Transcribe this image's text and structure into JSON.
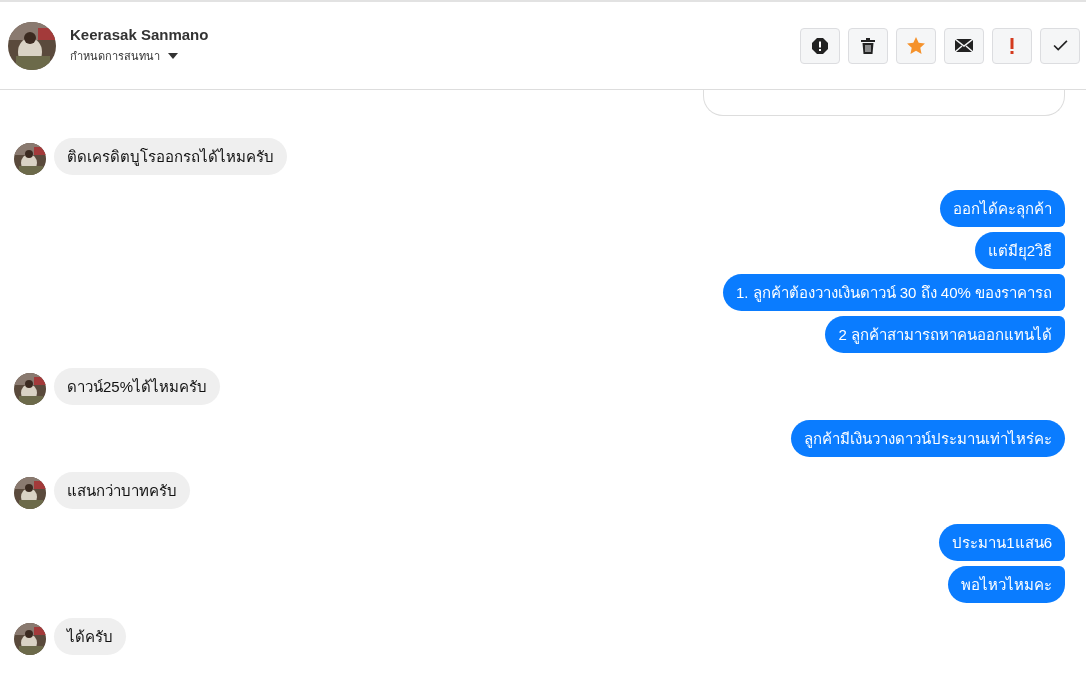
{
  "header": {
    "name": "Keerasak Sanmano",
    "subtitle": "กำหนดการสนทนา",
    "starred": true
  },
  "groups": [
    {
      "kind": "partial"
    },
    {
      "kind": "incoming",
      "messages": [
        "ติดเครดิตบูโรออกรถได้ไหมครับ"
      ]
    },
    {
      "kind": "outgoing",
      "messages": [
        "ออกได้คะลุกค้า",
        "แต่มียุ2วิธี",
        "1. ลูกค้าต้องวางเงินดาวน์ 30 ถึง 40% ของราคารถ",
        "2 ลูกค้าสามารถหาคนออกแทนได้"
      ]
    },
    {
      "kind": "incoming",
      "messages": [
        "ดาวน์25%ได้ไหมครับ"
      ]
    },
    {
      "kind": "outgoing",
      "messages": [
        "ลูกค้ามีเงินวางดาวน์ประมานเท่าไหร่คะ"
      ]
    },
    {
      "kind": "incoming",
      "messages": [
        "แสนกว่าบาทครับ"
      ]
    },
    {
      "kind": "outgoing",
      "messages": [
        "ประมาน1แสน6",
        "พอไหวไหมคะ"
      ]
    },
    {
      "kind": "incoming",
      "messages": [
        "ได้ครับ"
      ]
    }
  ]
}
